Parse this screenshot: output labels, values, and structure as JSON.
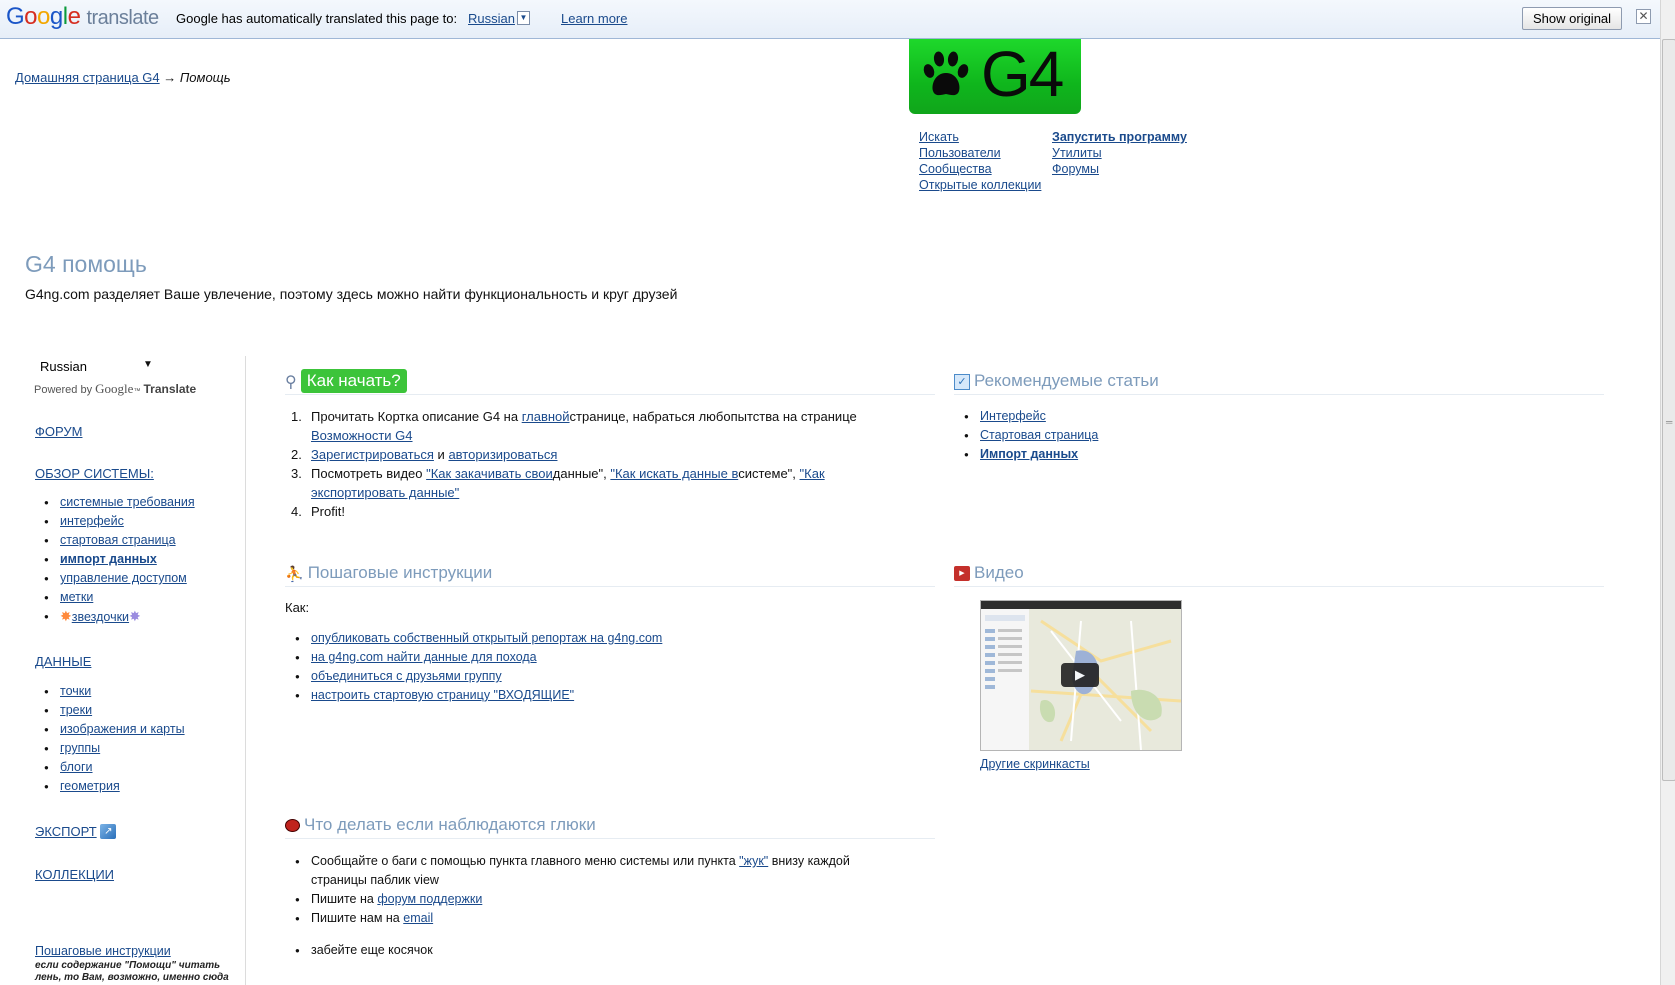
{
  "translate_bar": {
    "logo_google": "Google",
    "logo_translate": "translate",
    "message": "Google has automatically translated this page to:",
    "language": "Russian",
    "learn_more": "Learn more",
    "show_original": "Show original",
    "close": "✕"
  },
  "header": {
    "breadcrumb_home": "Домашняя страница G4",
    "breadcrumb_sep": "→",
    "breadcrumb_current": "Помощь",
    "logo_text": "G4",
    "nav_left": [
      "Искать",
      "Пользователи",
      "Сообщества",
      "Открытые коллекции"
    ],
    "nav_right": [
      "Запустить программу",
      "Утилиты",
      "Форумы"
    ]
  },
  "title": "G4 помощь",
  "subtitle": "G4ng.com разделяет Ваше увлечение, поэтому здесь можно найти функциональность и круг друзей",
  "sidebar": {
    "language": "Russian",
    "powered_by": "Powered by",
    "powered_google": "Google",
    "powered_translate": "Translate",
    "forum": "ФОРУМ",
    "overview": "ОБЗОР СИСТЕМЫ:",
    "overview_items": [
      "системные требования",
      "интерфейс",
      "стартовая страница",
      "импорт данных",
      "управление доступом",
      "метки",
      "звездочки"
    ],
    "data": "ДАННЫЕ",
    "data_items": [
      "точки",
      "треки",
      "изображения и карты",
      "группы",
      "блоги",
      "геометрия"
    ],
    "export": "ЭКСПОРТ",
    "collections": "КОЛЛЕКЦИИ",
    "footer_link": "Пошаговые инструкции",
    "footer_note": "если содержание \"Помощи\" читать лень, то Вам, возможно, именно сюда"
  },
  "start": {
    "heading": "Как начать?",
    "step1_a": "Прочитать Кортка описание G4 на ",
    "step1_link1": "главной",
    "step1_b": "странице, набраться любопытства на странице",
    "step1_link2": "Возможности G4",
    "step2_link1": "Зарегистрироваться",
    "step2_and": " и ",
    "step2_link2": "авторизироваться",
    "step3_a": "Посмотреть видео ",
    "step3_link1": "\"Как закачивать свои",
    "step3_b": "данные\", ",
    "step3_link2": "\"Как искать данные в",
    "step3_c": "системе\", ",
    "step3_link3a": "\"Как",
    "step3_link3b": "экспортировать данные\"",
    "step4": "Profit!"
  },
  "recommended": {
    "heading": "Рекомендуемые статьи",
    "items": [
      "Интерфейс",
      "Стартовая страница",
      "Импорт данных"
    ]
  },
  "instructions": {
    "heading": "Пошаговые инструкции",
    "intro": "Как:",
    "items": [
      "опубликовать собственный открытый репортаж на g4ng.com",
      "на g4ng.com найти данные для похода",
      "объединиться с друзьями группу",
      "настроить стартовую страницу \"ВХОДЯЩИЕ\""
    ]
  },
  "video": {
    "heading": "Видео",
    "more": "Другие скринкасты"
  },
  "bugs": {
    "heading": "Что делать если наблюдаются глюки",
    "item1_a": "Сообщайте о баги с помощью пункта главного меню системы или пункта ",
    "item1_link": "\"жук\"",
    "item1_b": " внизу каждой",
    "item1_c": "страницы паблик view",
    "item2_a": "Пишите на ",
    "item2_link": "форум поддержки",
    "item3_a": "Пишите нам на ",
    "item3_link": "email",
    "item4": "забейте еще косячок"
  }
}
